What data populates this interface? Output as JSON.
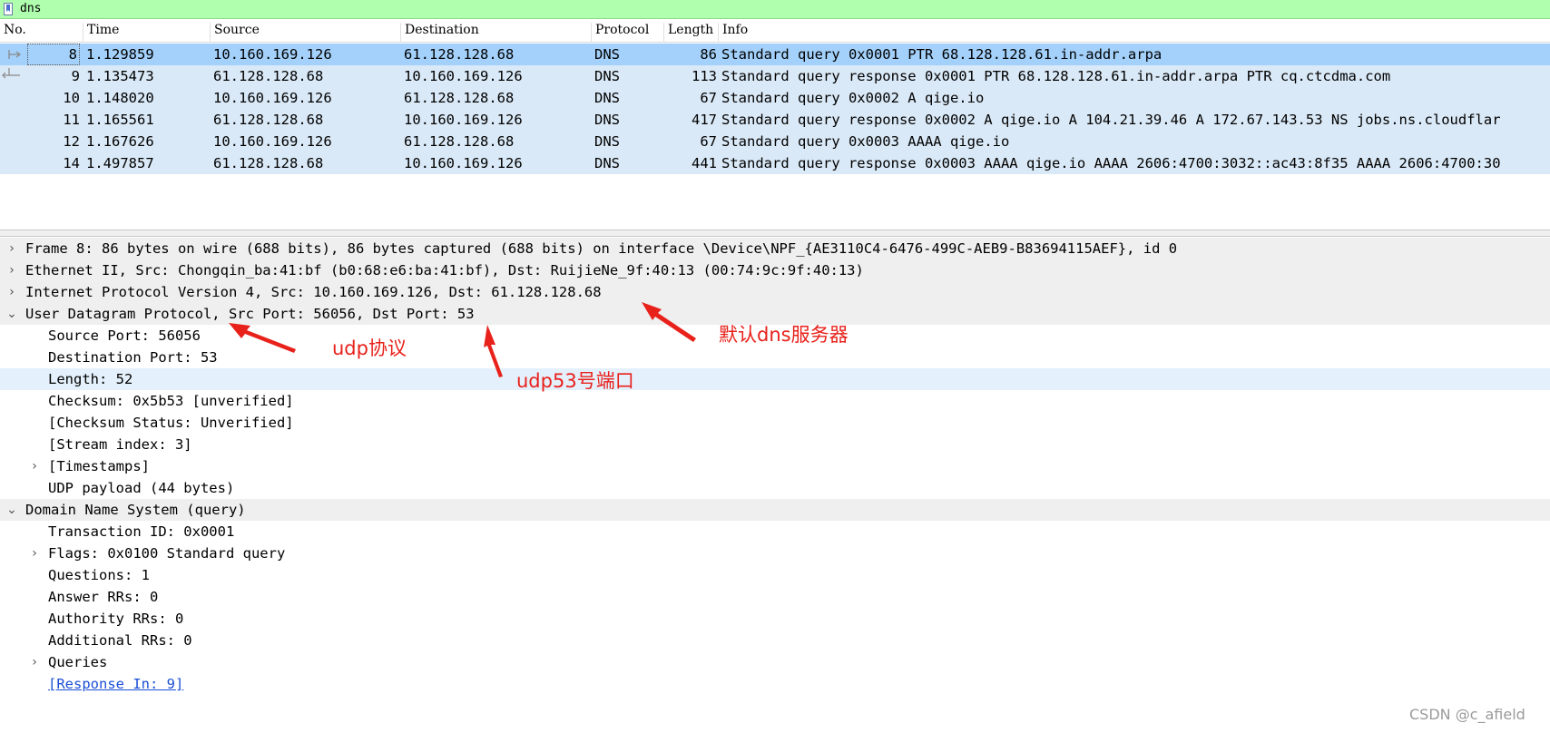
{
  "filter": {
    "text": "dns"
  },
  "packet_list": {
    "columns": [
      "No.",
      "Time",
      "Source",
      "Destination",
      "Protocol",
      "Length",
      "Info"
    ],
    "rows": [
      {
        "no": "8",
        "time": "1.129859",
        "source": "10.160.169.126",
        "destination": "61.128.128.68",
        "protocol": "DNS",
        "length": "86",
        "info": "Standard query 0x0001 PTR 68.128.128.61.in-addr.arpa",
        "selected": true
      },
      {
        "no": "9",
        "time": "1.135473",
        "source": "61.128.128.68",
        "destination": "10.160.169.126",
        "protocol": "DNS",
        "length": "113",
        "info": "Standard query response 0x0001 PTR 68.128.128.61.in-addr.arpa PTR cq.ctcdma.com",
        "selected": false
      },
      {
        "no": "10",
        "time": "1.148020",
        "source": "10.160.169.126",
        "destination": "61.128.128.68",
        "protocol": "DNS",
        "length": "67",
        "info": "Standard query 0x0002 A qige.io",
        "selected": false
      },
      {
        "no": "11",
        "time": "1.165561",
        "source": "61.128.128.68",
        "destination": "10.160.169.126",
        "protocol": "DNS",
        "length": "417",
        "info": "Standard query response 0x0002 A qige.io A 104.21.39.46 A 172.67.143.53 NS jobs.ns.cloudflar",
        "selected": false
      },
      {
        "no": "12",
        "time": "1.167626",
        "source": "10.160.169.126",
        "destination": "61.128.128.68",
        "protocol": "DNS",
        "length": "67",
        "info": "Standard query 0x0003 AAAA qige.io",
        "selected": false
      },
      {
        "no": "14",
        "time": "1.497857",
        "source": "61.128.128.68",
        "destination": "10.160.169.126",
        "protocol": "DNS",
        "length": "441",
        "info": "Standard query response 0x0003 AAAA qige.io AAAA 2606:4700:3032::ac43:8f35 AAAA 2606:4700:30",
        "selected": false
      }
    ]
  },
  "details": [
    {
      "indent": 0,
      "chevron": "›",
      "style": "grey",
      "text": "Frame 8: 86 bytes on wire (688 bits), 86 bytes captured (688 bits) on interface \\Device\\NPF_{AE3110C4-6476-499C-AEB9-B83694115AEF}, id 0"
    },
    {
      "indent": 0,
      "chevron": "›",
      "style": "grey",
      "text": "Ethernet II, Src: Chongqin_ba:41:bf (b0:68:e6:ba:41:bf), Dst: RuijieNe_9f:40:13 (00:74:9c:9f:40:13)"
    },
    {
      "indent": 0,
      "chevron": "›",
      "style": "grey",
      "text": "Internet Protocol Version 4, Src: 10.160.169.126, Dst: 61.128.128.68"
    },
    {
      "indent": 0,
      "chevron": "⌄",
      "style": "grey",
      "text": "User Datagram Protocol, Src Port: 56056, Dst Port: 53"
    },
    {
      "indent": 1,
      "chevron": "",
      "style": "",
      "text": "Source Port: 56056"
    },
    {
      "indent": 1,
      "chevron": "",
      "style": "",
      "text": "Destination Port: 53"
    },
    {
      "indent": 1,
      "chevron": "",
      "style": "hl",
      "text": "Length: 52"
    },
    {
      "indent": 1,
      "chevron": "",
      "style": "",
      "text": "Checksum: 0x5b53 [unverified]"
    },
    {
      "indent": 1,
      "chevron": "",
      "style": "",
      "text": "[Checksum Status: Unverified]"
    },
    {
      "indent": 1,
      "chevron": "",
      "style": "",
      "text": "[Stream index: 3]"
    },
    {
      "indent": 1,
      "chevron": "›",
      "style": "",
      "text": "[Timestamps]"
    },
    {
      "indent": 1,
      "chevron": "",
      "style": "",
      "text": "UDP payload (44 bytes)"
    },
    {
      "indent": 0,
      "chevron": "⌄",
      "style": "grey",
      "text": "Domain Name System (query)"
    },
    {
      "indent": 1,
      "chevron": "",
      "style": "",
      "text": "Transaction ID: 0x0001"
    },
    {
      "indent": 1,
      "chevron": "›",
      "style": "",
      "text": "Flags: 0x0100 Standard query"
    },
    {
      "indent": 1,
      "chevron": "",
      "style": "",
      "text": "Questions: 1"
    },
    {
      "indent": 1,
      "chevron": "",
      "style": "",
      "text": "Answer RRs: 0"
    },
    {
      "indent": 1,
      "chevron": "",
      "style": "",
      "text": "Authority RRs: 0"
    },
    {
      "indent": 1,
      "chevron": "",
      "style": "",
      "text": "Additional RRs: 0"
    },
    {
      "indent": 1,
      "chevron": "›",
      "style": "",
      "text": "Queries"
    },
    {
      "indent": 1,
      "chevron": "",
      "style": "link",
      "text": "[Response In: 9]"
    }
  ],
  "annotations": {
    "udp_protocol": "udp协议",
    "udp_port": "udp53号端口",
    "default_dns": "默认dns服务器",
    "color": "#e8211b"
  },
  "watermark": "CSDN @c_afield",
  "colors": {
    "filter_bg": "#afffaf",
    "row_bg": "#dae9f7",
    "selected_row_bg": "#a3d1fb",
    "link": "#1b4fd6"
  }
}
